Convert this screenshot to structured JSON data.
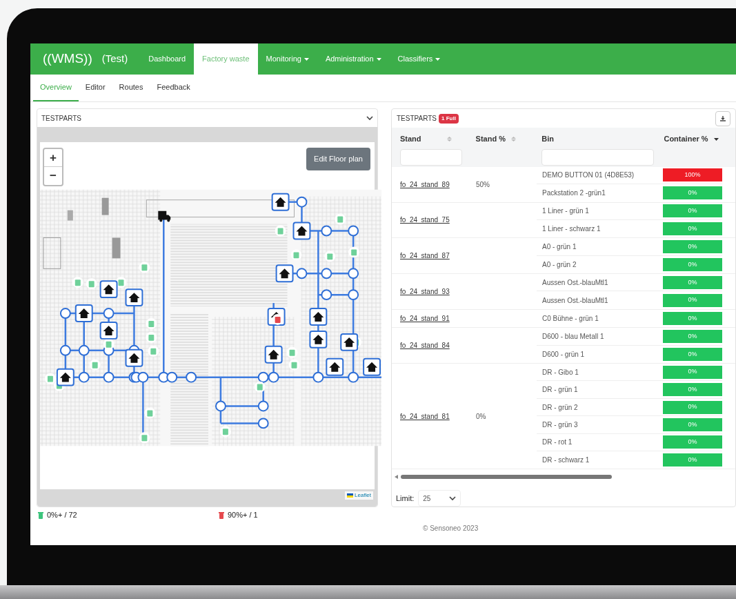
{
  "app": {
    "logo": "((WMS))",
    "environment": "(Test)"
  },
  "nav": [
    {
      "label": "Dashboard",
      "selected": false,
      "dropdown": false
    },
    {
      "label": "Factory waste",
      "selected": true,
      "dropdown": false
    },
    {
      "label": "Monitoring",
      "selected": false,
      "dropdown": true
    },
    {
      "label": "Administration",
      "selected": false,
      "dropdown": true
    },
    {
      "label": "Classifiers",
      "selected": false,
      "dropdown": true
    }
  ],
  "subtabs": [
    {
      "label": "Overview",
      "selected": true
    },
    {
      "label": "Editor",
      "selected": false
    },
    {
      "label": "Routes",
      "selected": false
    },
    {
      "label": "Feedback",
      "selected": false
    }
  ],
  "map_panel": {
    "title": "TESTPARTS",
    "edit_button": "Edit Floor plan",
    "zoom_in": "+",
    "zoom_out": "−",
    "attribution": "Leaflet",
    "legend": [
      {
        "text": "0%+ / 72",
        "color": "#3cc47c"
      },
      {
        "text": "90%+ / 1",
        "color": "#e5484d"
      }
    ]
  },
  "table_panel": {
    "title": "TESTPARTS",
    "badge": "1 Full",
    "columns": [
      {
        "label": "Stand",
        "sortable": true,
        "sorted_desc": false,
        "filter": true
      },
      {
        "label": "Stand %",
        "sortable": true,
        "sorted_desc": false,
        "filter": false
      },
      {
        "label": "Bin",
        "sortable": false,
        "filter": true
      },
      {
        "label": "Container %",
        "sortable": true,
        "sorted_desc": true,
        "filter": false
      }
    ],
    "groups": [
      {
        "stand": "fo_24_stand_89",
        "stand_percent": "50%",
        "bins": [
          {
            "name": "DEMO BUTTON 01 (4D8E53)",
            "reading": "100%",
            "full": true
          },
          {
            "name": "Packstation 2 -grün1",
            "reading": "0%",
            "full": false
          }
        ]
      },
      {
        "stand": "fo_24_stand_75",
        "bins": [
          {
            "name": "1 Liner - grün 1",
            "reading": "0%",
            "full": false
          },
          {
            "name": "1 Liner - schwarz 1",
            "reading": "0%",
            "full": false
          }
        ]
      },
      {
        "stand": "fo_24_stand_87",
        "bins": [
          {
            "name": "A0 - grün 1",
            "reading": "0%",
            "full": false
          },
          {
            "name": "A0 - grün 2",
            "reading": "0%",
            "full": false
          }
        ]
      },
      {
        "stand": "fo_24_stand_93",
        "bins": [
          {
            "name": "Aussen Ost.-blauMtl1",
            "reading": "0%",
            "full": false
          },
          {
            "name": "Aussen Ost.-blauMtl1",
            "reading": "0%",
            "full": false
          }
        ]
      },
      {
        "stand": "fo_24_stand_91",
        "bins": [
          {
            "name": "C0 Bühne - grün 1",
            "reading": "0%",
            "full": false
          }
        ]
      },
      {
        "stand": "fo_24_stand_84",
        "bins": [
          {
            "name": "D600 - blau Metall 1",
            "reading": "0%",
            "full": false
          },
          {
            "name": "D600 - grün 1",
            "reading": "0%",
            "full": false
          }
        ]
      },
      {
        "stand": "fo_24_stand_81",
        "stand_percent": "0%",
        "bins": [
          {
            "name": "DR - Gibo 1",
            "reading": "0%",
            "full": false
          },
          {
            "name": "DR - grün 1",
            "reading": "0%",
            "full": false
          },
          {
            "name": "DR - grün 2",
            "reading": "0%",
            "full": false
          },
          {
            "name": "DR - grün 3",
            "reading": "0%",
            "full": false
          },
          {
            "name": "DR - rot 1",
            "reading": "0%",
            "full": false
          },
          {
            "name": "DR - schwarz 1",
            "reading": "0%",
            "full": false
          }
        ]
      }
    ],
    "limit_label": "Limit:",
    "limit_value": "25"
  },
  "footer": "© Sensoneo 2023"
}
